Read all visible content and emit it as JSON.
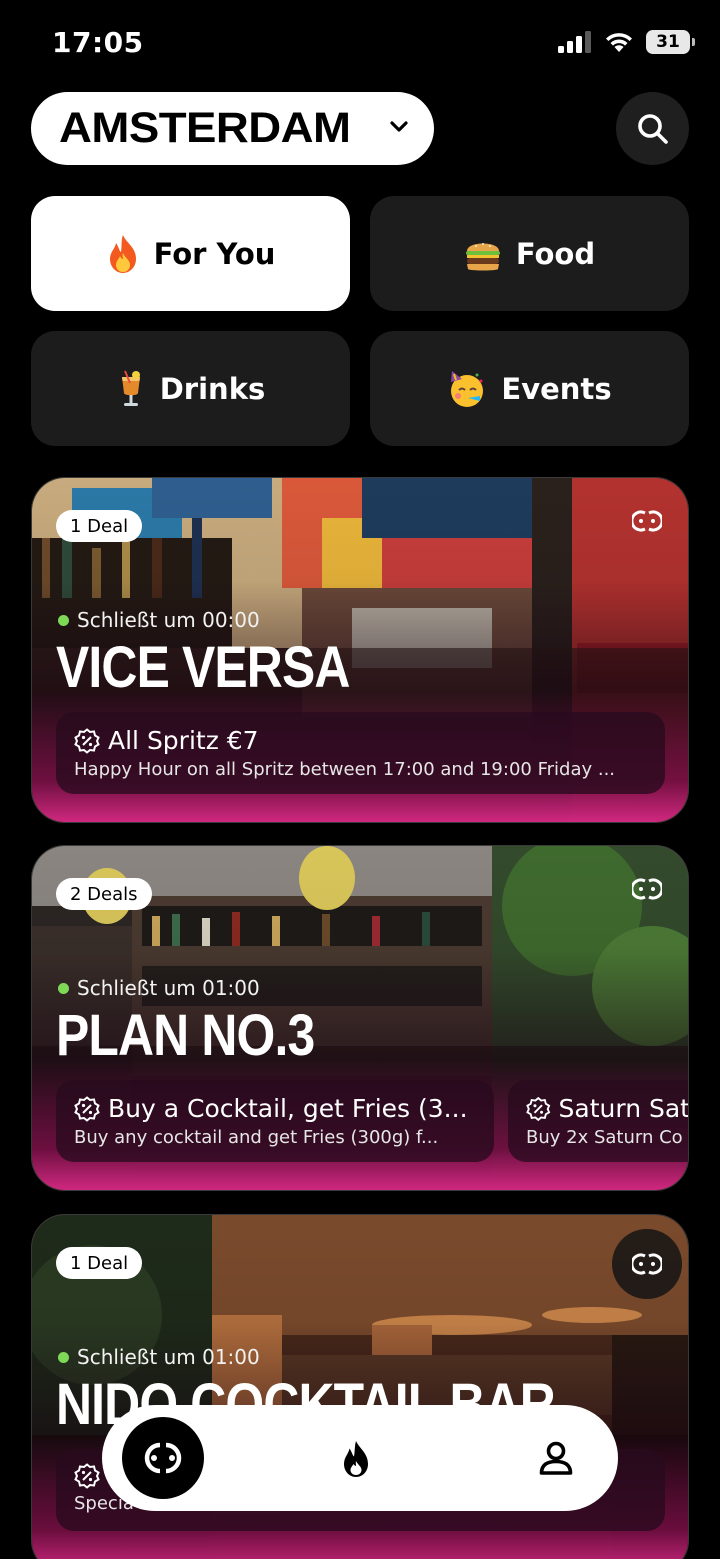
{
  "status_bar": {
    "time": "17:05",
    "battery": "31"
  },
  "header": {
    "city": "AMSTERDAM"
  },
  "categories": [
    {
      "label": "For You",
      "icon": "fire-icon",
      "active": true
    },
    {
      "label": "Food",
      "icon": "burger-icon",
      "active": false
    },
    {
      "label": "Drinks",
      "icon": "cocktail-icon",
      "active": false
    },
    {
      "label": "Events",
      "icon": "party-face-icon",
      "active": false
    }
  ],
  "venues": [
    {
      "deals_badge": "1 Deal",
      "open_status": "Schließt um 00:00",
      "name": "VICE VERSA",
      "deals": [
        {
          "title": "All Spritz €7",
          "description": "Happy Hour on all Spritz between 17:00 and 19:00 Friday ..."
        }
      ]
    },
    {
      "deals_badge": "2 Deals",
      "open_status": "Schließt um 01:00",
      "name": "PLAN NO.3",
      "deals": [
        {
          "title": "Buy a Cocktail, get Fries (3...",
          "description": "Buy any  cocktail and get Fries (300g) f..."
        },
        {
          "title": "Saturn Sat",
          "description": "Buy 2x Saturn Co"
        }
      ]
    },
    {
      "deals_badge": "1 Deal",
      "open_status": "Schließt um 01:00",
      "name": "NIDO COCKTAIL BAR",
      "deals": [
        {
          "title": "",
          "description": "Specia"
        }
      ]
    }
  ],
  "colors": {
    "accent_pink": "#d0287f",
    "open_green": "#7ed957",
    "tile_dark": "#1c1c1c"
  },
  "bottom_nav": {
    "items": [
      "home-logo-icon",
      "fire-icon",
      "profile-icon"
    ],
    "active": "home-logo-icon"
  }
}
